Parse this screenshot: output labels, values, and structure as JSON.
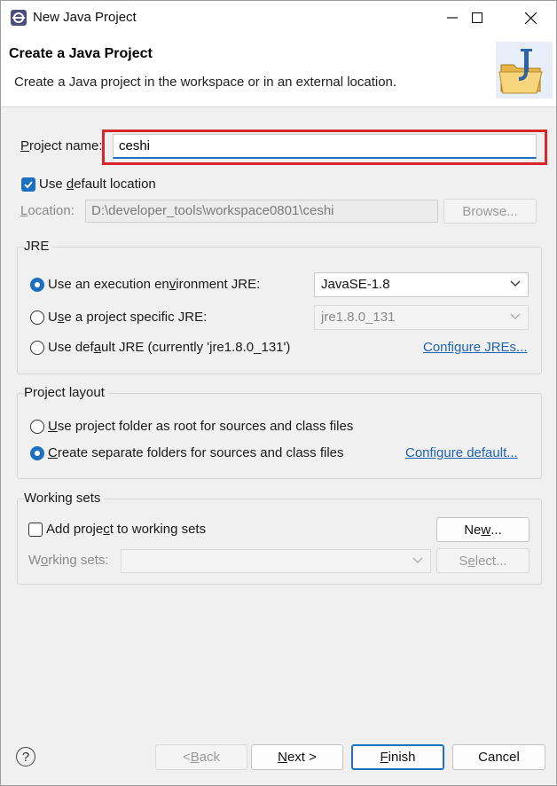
{
  "window": {
    "title": "New Java Project"
  },
  "header": {
    "title": "Create a Java Project",
    "description": "Create a Java project in the workspace or in an external location."
  },
  "project_name": {
    "label_prefix": "P",
    "label_rest": "roject name:",
    "value": "ceshi"
  },
  "location": {
    "use_default_prefix": "Use ",
    "use_default_ul": "d",
    "use_default_rest": "efault location",
    "use_default_checked": true,
    "label_prefix": "L",
    "label_rest": "ocation:",
    "value": "D:\\developer_tools\\workspace0801\\ceshi",
    "browse_label": "Browse..."
  },
  "jre": {
    "group_title": "JRE",
    "options": [
      {
        "label_a": "Use an execution en",
        "label_ul": "v",
        "label_b": "ironment JRE:",
        "selected": true
      },
      {
        "label_a": "U",
        "label_ul": "s",
        "label_b": "e a project specific JRE:",
        "selected": false
      },
      {
        "label_a": "Use def",
        "label_ul": "a",
        "label_b": "ult JRE (currently 'jre1.8.0_131')",
        "selected": false
      }
    ],
    "execution_env_value": "JavaSE-1.8",
    "project_jre_value": "jre1.8.0_131",
    "configure_link": "Configure JREs..."
  },
  "layout": {
    "group_title": "Project layout",
    "options": [
      {
        "label_a": "",
        "label_ul": "U",
        "label_b": "se project folder as root for sources and class files",
        "selected": false
      },
      {
        "label_a": "",
        "label_ul": "C",
        "label_b": "reate separate folders for sources and class files",
        "selected": true
      }
    ],
    "configure_link": "Configure default..."
  },
  "working_sets": {
    "group_title": "Working sets",
    "add_label_a": "Add proje",
    "add_label_ul": "c",
    "add_label_b": "t to working sets",
    "add_checked": false,
    "new_label_a": "Ne",
    "new_label_ul": "w",
    "new_label_b": "...",
    "sets_label_a": "W",
    "sets_label_ul": "o",
    "sets_label_b": "rking sets:",
    "select_label_a": "S",
    "select_label_ul": "e",
    "select_label_b": "lect..."
  },
  "footer": {
    "help_glyph": "?",
    "back_a": "< ",
    "back_ul": "B",
    "back_b": "ack",
    "next_ul": "N",
    "next_b": "ext >",
    "finish_ul": "F",
    "finish_b": "inish",
    "cancel_label": "Cancel"
  },
  "colors": {
    "accent": "#1f6fc1",
    "highlight_box": "#d9262b",
    "link": "#1f63b4"
  }
}
